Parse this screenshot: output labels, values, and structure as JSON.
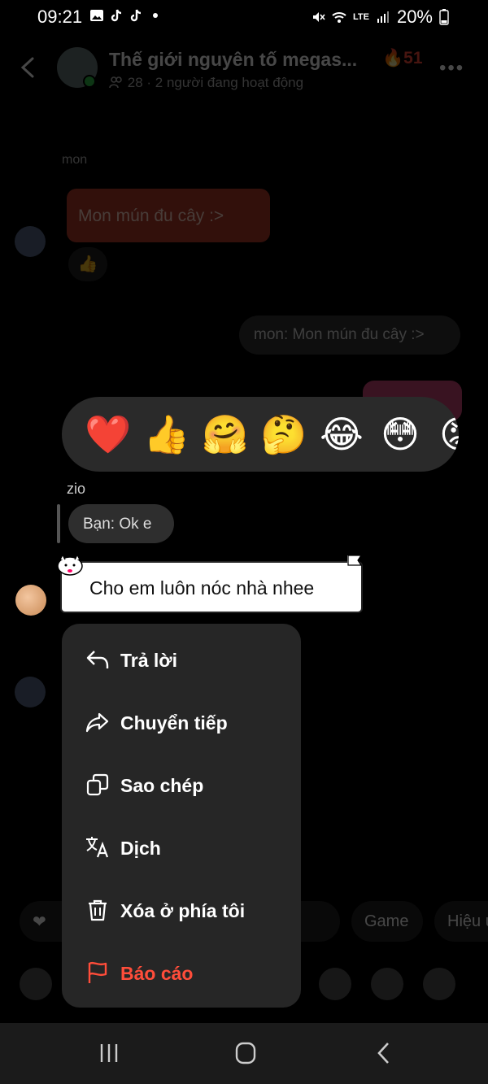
{
  "status_bar": {
    "time": "09:21",
    "battery": "20%",
    "network": "LTE"
  },
  "header": {
    "title": "Thế giới nguyên tố megas...",
    "streak": "51",
    "members_count": "28",
    "active_text": "· 2 người đang hoạt động"
  },
  "conversation": {
    "sender_mon": "mon",
    "mon_message": "Mon mún đu cây :>",
    "reaction_emoji": "👍",
    "reply_preview": "mon: Mon mún đu cây :>"
  },
  "reaction_picker": {
    "emojis": [
      "❤️",
      "👍",
      "🤗",
      "🤔",
      "😂",
      "😳",
      "😡"
    ]
  },
  "reply_context": {
    "sender": "zio",
    "quote": "Bạn: Ok e"
  },
  "focused_message": {
    "text": "Cho em luôn nóc nhà nhee"
  },
  "context_menu": {
    "items": [
      {
        "label": "Trả lời",
        "icon": "reply-icon"
      },
      {
        "label": "Chuyển tiếp",
        "icon": "forward-icon"
      },
      {
        "label": "Sao chép",
        "icon": "copy-icon"
      },
      {
        "label": "Dịch",
        "icon": "translate-icon"
      },
      {
        "label": "Xóa ở phía tôi",
        "icon": "trash-icon"
      },
      {
        "label": "Báo cáo",
        "icon": "flag-icon"
      }
    ]
  },
  "chips": {
    "game": "Game",
    "effects": "Hiệu ứng"
  },
  "colors": {
    "menu_bg": "#262626",
    "danger": "#ff4d3a",
    "picker_bg": "#2a2a2a"
  }
}
